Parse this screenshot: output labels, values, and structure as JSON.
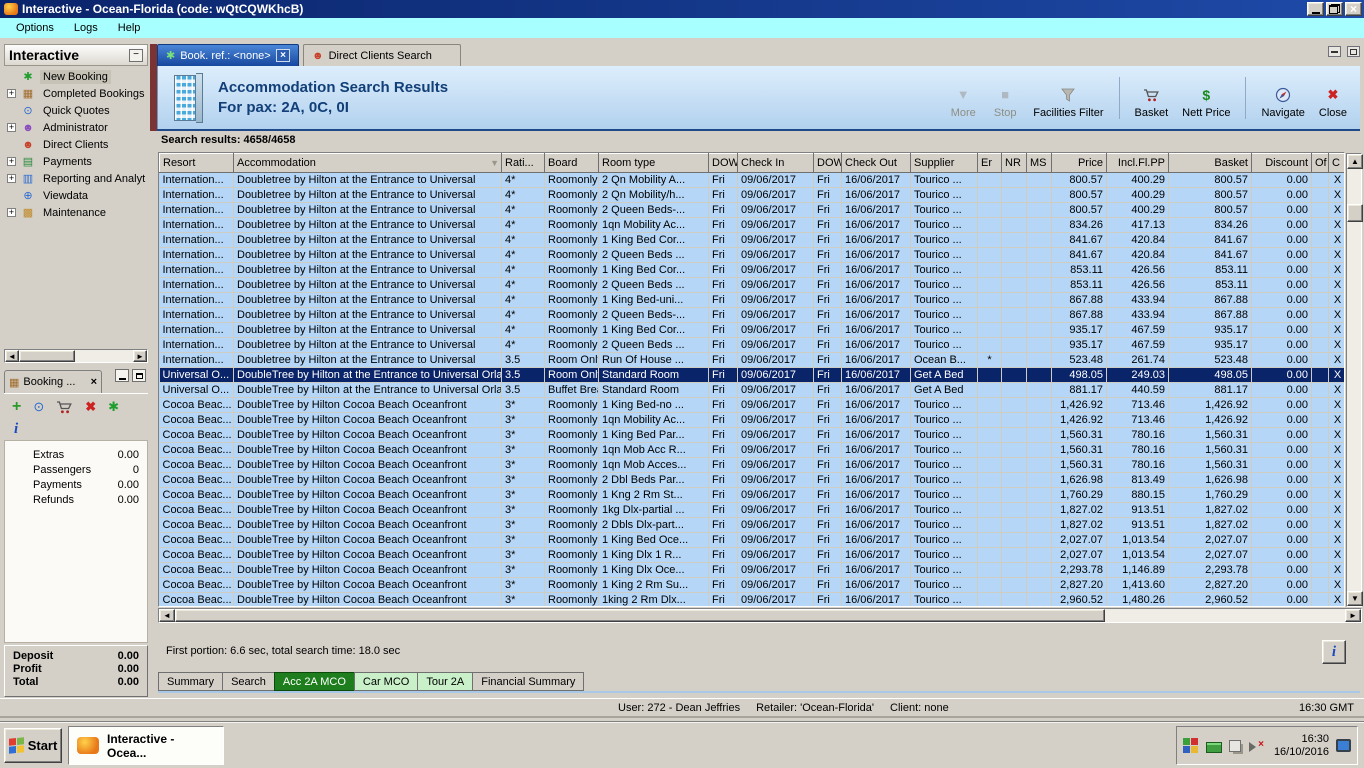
{
  "window": {
    "title": "Interactive - Ocean-Florida (code: wQtCQWKhcB)"
  },
  "menu": {
    "items": [
      {
        "name": "menu-options",
        "label": "Options"
      },
      {
        "name": "menu-logs",
        "label": "Logs"
      },
      {
        "name": "menu-help",
        "label": "Help"
      }
    ]
  },
  "sidebar": {
    "title": "Interactive",
    "tree": [
      {
        "name": "sidebar-item-new-booking",
        "label": "New Booking",
        "icon": "palm-tree",
        "selected": true
      },
      {
        "name": "sidebar-item-completed-bookings",
        "label": "Completed Bookings",
        "icon": "briefcase",
        "expandable": true
      },
      {
        "name": "sidebar-item-quick-quotes",
        "label": "Quick Quotes",
        "icon": "clock"
      },
      {
        "name": "sidebar-item-administrator",
        "label": "Administrator",
        "icon": "admin-person",
        "expandable": true
      },
      {
        "name": "sidebar-item-direct-clients",
        "label": "Direct Clients",
        "icon": "person"
      },
      {
        "name": "sidebar-item-payments",
        "label": "Payments",
        "icon": "payments-card",
        "expandable": true
      },
      {
        "name": "sidebar-item-reporting",
        "label": "Reporting and Analyt",
        "icon": "report",
        "expandable": true
      },
      {
        "name": "sidebar-item-viewdata",
        "label": "Viewdata",
        "icon": "globe"
      },
      {
        "name": "sidebar-item-maintenance",
        "label": "Maintenance",
        "icon": "toolbox",
        "expandable": true
      }
    ]
  },
  "booking_panel": {
    "tab_label": "Booking ...",
    "close_label": "×",
    "toolbar": [
      {
        "name": "booking-add-button",
        "icon": "plus"
      },
      {
        "name": "booking-quote-button",
        "icon": "clock"
      },
      {
        "name": "booking-basket-button",
        "icon": "cart"
      },
      {
        "name": "booking-delete-button",
        "icon": "red-x"
      },
      {
        "name": "booking-new-button",
        "icon": "palm-tree"
      }
    ],
    "info_glyph": "i",
    "stats": [
      {
        "label": "Extras",
        "value": "0.00"
      },
      {
        "label": "Passengers",
        "value": "0"
      },
      {
        "label": "Payments",
        "value": "0.00"
      },
      {
        "label": "Refunds",
        "value": "0.00"
      }
    ],
    "totals": [
      {
        "label": "Deposit",
        "value": "0.00"
      },
      {
        "label": "Profit",
        "value": "0.00"
      },
      {
        "label": "Total",
        "value": "0.00"
      }
    ]
  },
  "content": {
    "tabs": {
      "book_ref": {
        "label": "Book. ref.: <none>",
        "close": "×"
      },
      "direct_clients": {
        "label": "Direct Clients Search"
      }
    },
    "header": {
      "title": "Accommodation Search Results",
      "subtitle": "For pax: 2A, 0C, 0I"
    },
    "toolbar": [
      {
        "name": "more-button",
        "label": "More",
        "icon": "down-arrow",
        "disabled": true
      },
      {
        "name": "stop-button",
        "label": "Stop",
        "icon": "stop-square",
        "disabled": true
      },
      {
        "name": "facilities-filter-button",
        "label": "Facilities Filter",
        "icon": "funnel"
      },
      {
        "cls": "sep"
      },
      {
        "name": "basket-button",
        "label": "Basket",
        "icon": "cart"
      },
      {
        "name": "nett-price-button",
        "label": "Nett Price",
        "icon": "dollar"
      },
      {
        "cls": "sep"
      },
      {
        "name": "navigate-button",
        "label": "Navigate",
        "icon": "compass"
      },
      {
        "name": "close-button",
        "label": "Close",
        "icon": "red-x"
      }
    ],
    "search_results_label": "Search results: 4658/4658",
    "status_line": "First portion: 6.6 sec, total search time: 18.0 sec",
    "info_glyph": "i",
    "bottom_tabs": [
      {
        "name": "tab-summary",
        "label": "Summary"
      },
      {
        "name": "tab-search",
        "label": "Search"
      },
      {
        "name": "tab-acc-2a-mco",
        "label": "Acc 2A MCO",
        "cls": "tab-green-active"
      },
      {
        "name": "tab-car-mco",
        "label": "Car MCO",
        "cls": "tab-green"
      },
      {
        "name": "tab-tour-2a",
        "label": "Tour 2A",
        "cls": "tab-green"
      },
      {
        "name": "tab-financial-summary",
        "label": "Financial Summary"
      }
    ]
  },
  "table": {
    "columns": [
      "Resort",
      "Accommodation",
      "Rati...",
      "Board",
      "Room type",
      "DOW",
      "Check In",
      "DOW",
      "Check Out",
      "Supplier",
      "Er",
      "NR",
      "MS",
      "Price",
      "Incl.Fl.PP",
      "Basket",
      "Discount",
      "Of",
      "C"
    ],
    "sort_column": 1,
    "selected_row": 13,
    "numeric_cols": [
      13,
      14,
      15,
      16
    ],
    "center_cols": [
      10,
      18
    ],
    "rows": [
      [
        "Internation...",
        "Doubletree by Hilton at the Entrance to Universal",
        "4*",
        "Roomonly",
        "2 Qn Mobility A...",
        "Fri",
        "09/06/2017",
        "Fri",
        "16/06/2017",
        "Tourico ...",
        "",
        "",
        "",
        "800.57",
        "400.29",
        "800.57",
        "0.00",
        "",
        "X"
      ],
      [
        "Internation...",
        "Doubletree by Hilton at the Entrance to Universal",
        "4*",
        "Roomonly",
        "2 Qn Mobility/h...",
        "Fri",
        "09/06/2017",
        "Fri",
        "16/06/2017",
        "Tourico ...",
        "",
        "",
        "",
        "800.57",
        "400.29",
        "800.57",
        "0.00",
        "",
        "X"
      ],
      [
        "Internation...",
        "Doubletree by Hilton at the Entrance to Universal",
        "4*",
        "Roomonly",
        "2 Queen Beds-...",
        "Fri",
        "09/06/2017",
        "Fri",
        "16/06/2017",
        "Tourico ...",
        "",
        "",
        "",
        "800.57",
        "400.29",
        "800.57",
        "0.00",
        "",
        "X"
      ],
      [
        "Internation...",
        "Doubletree by Hilton at the Entrance to Universal",
        "4*",
        "Roomonly",
        "1qn Mobility Ac...",
        "Fri",
        "09/06/2017",
        "Fri",
        "16/06/2017",
        "Tourico ...",
        "",
        "",
        "",
        "834.26",
        "417.13",
        "834.26",
        "0.00",
        "",
        "X"
      ],
      [
        "Internation...",
        "Doubletree by Hilton at the Entrance to Universal",
        "4*",
        "Roomonly",
        "1 King Bed Cor...",
        "Fri",
        "09/06/2017",
        "Fri",
        "16/06/2017",
        "Tourico ...",
        "",
        "",
        "",
        "841.67",
        "420.84",
        "841.67",
        "0.00",
        "",
        "X"
      ],
      [
        "Internation...",
        "Doubletree by Hilton at the Entrance to Universal",
        "4*",
        "Roomonly",
        "2 Queen Beds ...",
        "Fri",
        "09/06/2017",
        "Fri",
        "16/06/2017",
        "Tourico ...",
        "",
        "",
        "",
        "841.67",
        "420.84",
        "841.67",
        "0.00",
        "",
        "X"
      ],
      [
        "Internation...",
        "Doubletree by Hilton at the Entrance to Universal",
        "4*",
        "Roomonly",
        "1 King Bed Cor...",
        "Fri",
        "09/06/2017",
        "Fri",
        "16/06/2017",
        "Tourico ...",
        "",
        "",
        "",
        "853.11",
        "426.56",
        "853.11",
        "0.00",
        "",
        "X"
      ],
      [
        "Internation...",
        "Doubletree by Hilton at the Entrance to Universal",
        "4*",
        "Roomonly",
        "2 Queen Beds ...",
        "Fri",
        "09/06/2017",
        "Fri",
        "16/06/2017",
        "Tourico ...",
        "",
        "",
        "",
        "853.11",
        "426.56",
        "853.11",
        "0.00",
        "",
        "X"
      ],
      [
        "Internation...",
        "Doubletree by Hilton at the Entrance to Universal",
        "4*",
        "Roomonly",
        "1 King Bed-uni...",
        "Fri",
        "09/06/2017",
        "Fri",
        "16/06/2017",
        "Tourico ...",
        "",
        "",
        "",
        "867.88",
        "433.94",
        "867.88",
        "0.00",
        "",
        "X"
      ],
      [
        "Internation...",
        "Doubletree by Hilton at the Entrance to Universal",
        "4*",
        "Roomonly",
        "2 Queen Beds-...",
        "Fri",
        "09/06/2017",
        "Fri",
        "16/06/2017",
        "Tourico ...",
        "",
        "",
        "",
        "867.88",
        "433.94",
        "867.88",
        "0.00",
        "",
        "X"
      ],
      [
        "Internation...",
        "Doubletree by Hilton at the Entrance to Universal",
        "4*",
        "Roomonly",
        "1 King Bed Cor...",
        "Fri",
        "09/06/2017",
        "Fri",
        "16/06/2017",
        "Tourico ...",
        "",
        "",
        "",
        "935.17",
        "467.59",
        "935.17",
        "0.00",
        "",
        "X"
      ],
      [
        "Internation...",
        "Doubletree by Hilton at the Entrance to Universal",
        "4*",
        "Roomonly",
        "2 Queen Beds ...",
        "Fri",
        "09/06/2017",
        "Fri",
        "16/06/2017",
        "Tourico ...",
        "",
        "",
        "",
        "935.17",
        "467.59",
        "935.17",
        "0.00",
        "",
        "X"
      ],
      [
        "Internation...",
        "Doubletree by Hilton at the Entrance to Universal",
        "3.5",
        "Room Only",
        "Run Of House ...",
        "Fri",
        "09/06/2017",
        "Fri",
        "16/06/2017",
        "Ocean B...",
        "*",
        "",
        "",
        "523.48",
        "261.74",
        "523.48",
        "0.00",
        "",
        "X"
      ],
      [
        "Universal O...",
        "DoubleTree by Hilton at the Entrance to Universal Orlando",
        "3.5",
        "Room Only",
        "Standard Room",
        "Fri",
        "09/06/2017",
        "Fri",
        "16/06/2017",
        "Get A Bed",
        "",
        "",
        "",
        "498.05",
        "249.03",
        "498.05",
        "0.00",
        "",
        "X"
      ],
      [
        "Universal O...",
        "DoubleTree by Hilton at the Entrance to Universal Orlando",
        "3.5",
        "Buffet Brea...",
        "Standard Room",
        "Fri",
        "09/06/2017",
        "Fri",
        "16/06/2017",
        "Get A Bed",
        "",
        "",
        "",
        "881.17",
        "440.59",
        "881.17",
        "0.00",
        "",
        "X"
      ],
      [
        "Cocoa Beac...",
        "DoubleTree by Hilton Cocoa Beach Oceanfront",
        "3*",
        "Roomonly",
        "1 King Bed-no ...",
        "Fri",
        "09/06/2017",
        "Fri",
        "16/06/2017",
        "Tourico ...",
        "",
        "",
        "",
        "1,426.92",
        "713.46",
        "1,426.92",
        "0.00",
        "",
        "X"
      ],
      [
        "Cocoa Beac...",
        "DoubleTree by Hilton Cocoa Beach Oceanfront",
        "3*",
        "Roomonly",
        "1qn Mobility Ac...",
        "Fri",
        "09/06/2017",
        "Fri",
        "16/06/2017",
        "Tourico ...",
        "",
        "",
        "",
        "1,426.92",
        "713.46",
        "1,426.92",
        "0.00",
        "",
        "X"
      ],
      [
        "Cocoa Beac...",
        "DoubleTree by Hilton Cocoa Beach Oceanfront",
        "3*",
        "Roomonly",
        "1 King Bed Par...",
        "Fri",
        "09/06/2017",
        "Fri",
        "16/06/2017",
        "Tourico ...",
        "",
        "",
        "",
        "1,560.31",
        "780.16",
        "1,560.31",
        "0.00",
        "",
        "X"
      ],
      [
        "Cocoa Beac...",
        "DoubleTree by Hilton Cocoa Beach Oceanfront",
        "3*",
        "Roomonly",
        "1qn Mob Acc R...",
        "Fri",
        "09/06/2017",
        "Fri",
        "16/06/2017",
        "Tourico ...",
        "",
        "",
        "",
        "1,560.31",
        "780.16",
        "1,560.31",
        "0.00",
        "",
        "X"
      ],
      [
        "Cocoa Beac...",
        "DoubleTree by Hilton Cocoa Beach Oceanfront",
        "3*",
        "Roomonly",
        "1qn Mob Acces...",
        "Fri",
        "09/06/2017",
        "Fri",
        "16/06/2017",
        "Tourico ...",
        "",
        "",
        "",
        "1,560.31",
        "780.16",
        "1,560.31",
        "0.00",
        "",
        "X"
      ],
      [
        "Cocoa Beac...",
        "DoubleTree by Hilton Cocoa Beach Oceanfront",
        "3*",
        "Roomonly",
        "2 Dbl Beds Par...",
        "Fri",
        "09/06/2017",
        "Fri",
        "16/06/2017",
        "Tourico ...",
        "",
        "",
        "",
        "1,626.98",
        "813.49",
        "1,626.98",
        "0.00",
        "",
        "X"
      ],
      [
        "Cocoa Beac...",
        "DoubleTree by Hilton Cocoa Beach Oceanfront",
        "3*",
        "Roomonly",
        "1 Kng 2 Rm St...",
        "Fri",
        "09/06/2017",
        "Fri",
        "16/06/2017",
        "Tourico ...",
        "",
        "",
        "",
        "1,760.29",
        "880.15",
        "1,760.29",
        "0.00",
        "",
        "X"
      ],
      [
        "Cocoa Beac...",
        "DoubleTree by Hilton Cocoa Beach Oceanfront",
        "3*",
        "Roomonly",
        "1kg Dlx-partial ...",
        "Fri",
        "09/06/2017",
        "Fri",
        "16/06/2017",
        "Tourico ...",
        "",
        "",
        "",
        "1,827.02",
        "913.51",
        "1,827.02",
        "0.00",
        "",
        "X"
      ],
      [
        "Cocoa Beac...",
        "DoubleTree by Hilton Cocoa Beach Oceanfront",
        "3*",
        "Roomonly",
        "2 Dbls Dlx-part...",
        "Fri",
        "09/06/2017",
        "Fri",
        "16/06/2017",
        "Tourico ...",
        "",
        "",
        "",
        "1,827.02",
        "913.51",
        "1,827.02",
        "0.00",
        "",
        "X"
      ],
      [
        "Cocoa Beac...",
        "DoubleTree by Hilton Cocoa Beach Oceanfront",
        "3*",
        "Roomonly",
        "1 King Bed Oce...",
        "Fri",
        "09/06/2017",
        "Fri",
        "16/06/2017",
        "Tourico ...",
        "",
        "",
        "",
        "2,027.07",
        "1,013.54",
        "2,027.07",
        "0.00",
        "",
        "X"
      ],
      [
        "Cocoa Beac...",
        "DoubleTree by Hilton Cocoa Beach Oceanfront",
        "3*",
        "Roomonly",
        "1 King Dlx 1 R...",
        "Fri",
        "09/06/2017",
        "Fri",
        "16/06/2017",
        "Tourico ...",
        "",
        "",
        "",
        "2,027.07",
        "1,013.54",
        "2,027.07",
        "0.00",
        "",
        "X"
      ],
      [
        "Cocoa Beac...",
        "DoubleTree by Hilton Cocoa Beach Oceanfront",
        "3*",
        "Roomonly",
        "1 King Dlx Oce...",
        "Fri",
        "09/06/2017",
        "Fri",
        "16/06/2017",
        "Tourico ...",
        "",
        "",
        "",
        "2,293.78",
        "1,146.89",
        "2,293.78",
        "0.00",
        "",
        "X"
      ],
      [
        "Cocoa Beac...",
        "DoubleTree by Hilton Cocoa Beach Oceanfront",
        "3*",
        "Roomonly",
        "1 King 2 Rm Su...",
        "Fri",
        "09/06/2017",
        "Fri",
        "16/06/2017",
        "Tourico ...",
        "",
        "",
        "",
        "2,827.20",
        "1,413.60",
        "2,827.20",
        "0.00",
        "",
        "X"
      ],
      [
        "Cocoa Beac...",
        "DoubleTree by Hilton Cocoa Beach Oceanfront",
        "3*",
        "Roomonly",
        "1king 2 Rm Dlx...",
        "Fri",
        "09/06/2017",
        "Fri",
        "16/06/2017",
        "Tourico ...",
        "",
        "",
        "",
        "2,960.52",
        "1,480.26",
        "2,960.52",
        "0.00",
        "",
        "X"
      ]
    ]
  },
  "status_bar": {
    "user": "User: 272 - Dean Jeffries",
    "retailer": "Retailer: 'Ocean-Florida'",
    "client": "Client: none",
    "time": "16:30 GMT"
  },
  "taskbar": {
    "start_label": "Start",
    "task_label": "Interactive - Ocea...",
    "clock_time": "16:30",
    "clock_date": "16/10/2016"
  }
}
